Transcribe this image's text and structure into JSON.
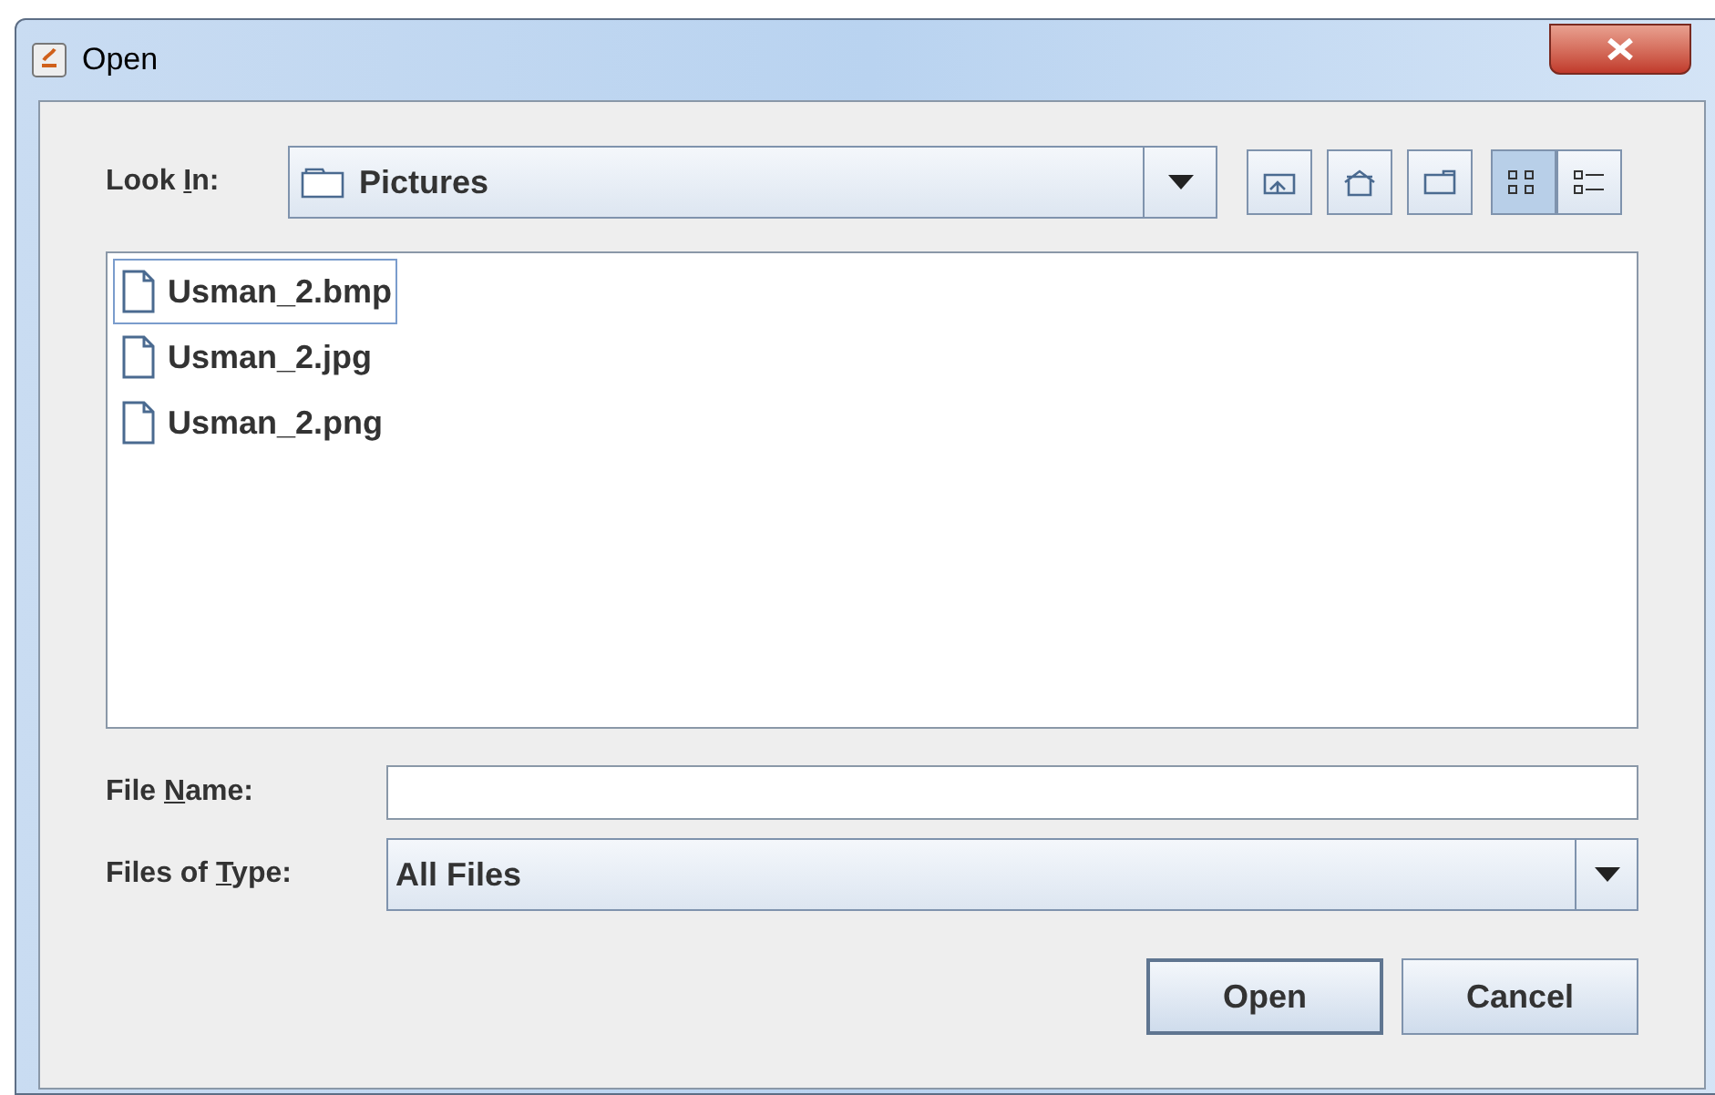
{
  "window": {
    "title": "Open"
  },
  "look_in": {
    "label": {
      "before": "Look ",
      "key": "I",
      "after": "n:"
    },
    "value": "Pictures"
  },
  "view_buttons": [
    {
      "kind": "list",
      "selected": true
    },
    {
      "kind": "details",
      "selected": false
    }
  ],
  "files": [
    {
      "name": "Usman_2.bmp",
      "selected": true
    },
    {
      "name": "Usman_2.jpg",
      "selected": false
    },
    {
      "name": "Usman_2.png",
      "selected": false
    }
  ],
  "file_name": {
    "label": {
      "before": "File ",
      "key": "N",
      "after": "ame:"
    }
  },
  "file_type": {
    "label": {
      "before": "Files of ",
      "key": "T",
      "after": "ype:"
    },
    "value": "All Files"
  },
  "buttons": [
    {
      "label": "Open",
      "default": true
    },
    {
      "label": "Cancel",
      "default": false
    }
  ]
}
